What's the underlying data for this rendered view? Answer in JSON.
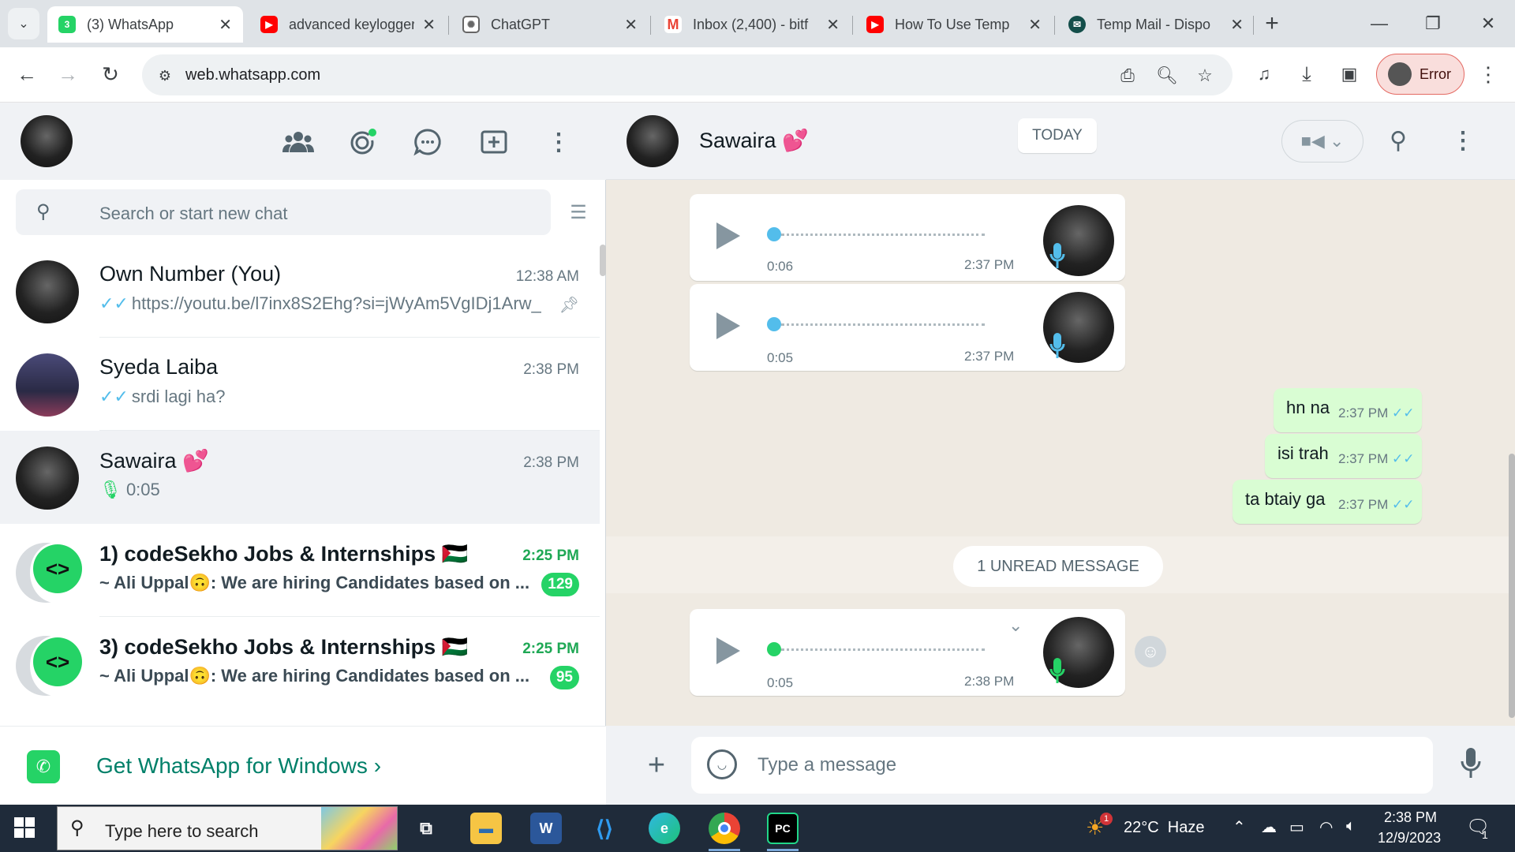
{
  "browser": {
    "tabs": [
      {
        "title": "(3) WhatsApp",
        "favicon": "whatsapp-icon",
        "active": true
      },
      {
        "title": "advanced keylogger",
        "favicon": "youtube-icon"
      },
      {
        "title": "ChatGPT",
        "favicon": "chatgpt-icon"
      },
      {
        "title": "Inbox (2,400) - bitf",
        "favicon": "gmail-icon"
      },
      {
        "title": "How To Use Temp",
        "favicon": "youtube-icon"
      },
      {
        "title": "Temp Mail - Dispo",
        "favicon": "tempmail-icon"
      }
    ],
    "url": "web.whatsapp.com",
    "profile_label": "Error"
  },
  "sidebar": {
    "search_placeholder": "Search or start new chat",
    "chats": [
      {
        "name": "Own Number (You)",
        "time": "12:38 AM",
        "preview": "https://youtu.be/l7inx8S2Ehg?si=jWyAm5VgIDj1Arw_",
        "ticks": "✓✓",
        "pinned": true
      },
      {
        "name": "Syeda Laiba",
        "time": "2:38 PM",
        "preview": "srdi lagi ha?",
        "ticks": "✓✓"
      },
      {
        "name": "Sawaira 💕",
        "time": "2:38 PM",
        "preview": "0:05",
        "voice": true,
        "selected": true
      },
      {
        "name": "1) codeSekho Jobs & Internships 🇵🇸",
        "time": "2:25 PM",
        "preview": "~ Ali Uppal🙃: We are hiring Candidates based on ...",
        "unread": "129"
      },
      {
        "name": "3) codeSekho Jobs & Internships 🇵🇸",
        "time": "2:25 PM",
        "preview": "~ Ali Uppal🙃: We are hiring Candidates based on ...",
        "unread": "95"
      }
    ],
    "get_windows": "Get WhatsApp for Windows"
  },
  "conversation": {
    "contact_name": "Sawaira 💕",
    "date_chip": "TODAY",
    "voice_notes": [
      {
        "duration": "0:06",
        "time": "2:37 PM"
      },
      {
        "duration": "0:05",
        "time": "2:37 PM"
      },
      {
        "duration": "0:05",
        "time": "2:38 PM"
      }
    ],
    "sent_messages": [
      {
        "text": "hn na",
        "time": "2:37 PM"
      },
      {
        "text": "isi trah",
        "time": "2:37 PM"
      },
      {
        "text": "ta btaiy ga",
        "time": "2:37 PM"
      }
    ],
    "unread_label": "1 UNREAD MESSAGE",
    "composer_placeholder": "Type a message"
  },
  "taskbar": {
    "search_placeholder": "Type here to search",
    "weather": "22°C  Haze",
    "weather_badge": "1",
    "time": "2:38 PM",
    "date": "12/9/2023",
    "notification_count": "1"
  },
  "colors": {
    "whatsapp_green": "#25d366",
    "tick_blue": "#53bdeb",
    "outgoing_bubble": "#d9fdd3"
  }
}
